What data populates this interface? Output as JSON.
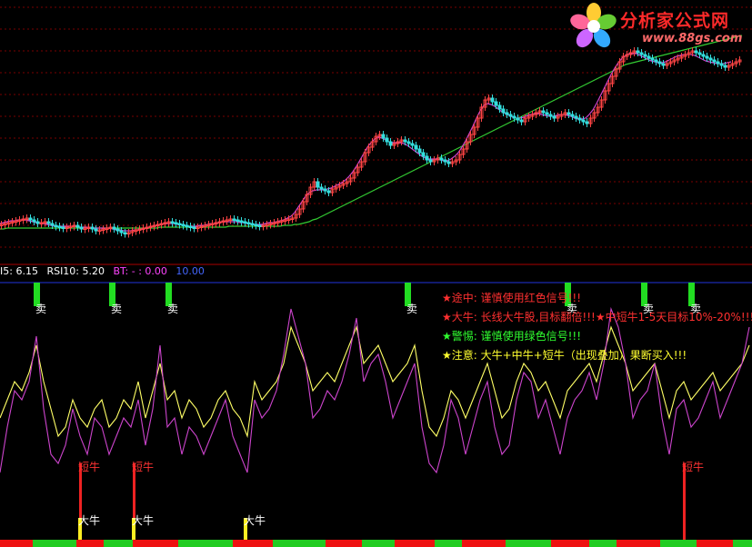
{
  "header": {
    "item1": {
      "label": "I5: 6.15",
      "color": "#ffffff"
    },
    "item2": {
      "label": "RSI10: 5.20",
      "color": "#ffffff"
    },
    "item3": {
      "label": "BT: -  : 0.00",
      "color": "#ff44ff"
    },
    "item4": {
      "label": "10.00",
      "color": "#4466ff"
    }
  },
  "notes": [
    {
      "text": "★途中: 谨慎使用红色信号!!!",
      "color": "#ff3030"
    },
    {
      "text": "★大牛: 长线大牛股,目标翻倍!!!★中短牛1-5天目标10%-20%!!!",
      "color": "#ff3030"
    },
    {
      "text": "★警惕: 谨慎使用绿色信号!!!",
      "color": "#30ff30"
    },
    {
      "text": "★注意: 大牛+中牛+短牛（出现叠加）果断买入!!!",
      "color": "#ffff30"
    }
  ],
  "logo": {
    "title": "分析家公式网",
    "url": "www.88gs.com",
    "icon": "flower-logo-icon"
  },
  "chart_data": [
    {
      "type": "candlestick",
      "panel": "price",
      "x": [
        0,
        4,
        8,
        12,
        16,
        20,
        24,
        28,
        32,
        36,
        40,
        44,
        48,
        52,
        56,
        60,
        64,
        68,
        72,
        76,
        80,
        84,
        88,
        92,
        96,
        100,
        104,
        108,
        112,
        116,
        120,
        124,
        128,
        132,
        136,
        140,
        144,
        148,
        152,
        156,
        160,
        164,
        168,
        172,
        176,
        180,
        184,
        188,
        192,
        196,
        200,
        204,
        208,
        212,
        216,
        220,
        224,
        228,
        232,
        236,
        240,
        244,
        248,
        252,
        256,
        260,
        264,
        268,
        272,
        276,
        280,
        284,
        288,
        292,
        296,
        300,
        304,
        308,
        312,
        316,
        320,
        324,
        328,
        332,
        336,
        340,
        344,
        348,
        352,
        356,
        360,
        364,
        368,
        372,
        376,
        380,
        384,
        388,
        392,
        396,
        400,
        404,
        408,
        412,
        416,
        420,
        424,
        428,
        432,
        436,
        440,
        444,
        448,
        452,
        456,
        460,
        464,
        468,
        472,
        476,
        480,
        484,
        488,
        492,
        496,
        500,
        504,
        508,
        512,
        516,
        520,
        524,
        528,
        532,
        536,
        540,
        544,
        548,
        552,
        556,
        560,
        564,
        568,
        572,
        576,
        580,
        584,
        588,
        592,
        596,
        600,
        604,
        608,
        612,
        616,
        620,
        624,
        628,
        632,
        636,
        640,
        644,
        648,
        652,
        656,
        660,
        664,
        668,
        672,
        676,
        680,
        684,
        688,
        692,
        696,
        700,
        704,
        708,
        712,
        716,
        720,
        724,
        728,
        732,
        736,
        740,
        744,
        748,
        752,
        756,
        760,
        764,
        768,
        772,
        776,
        780,
        784,
        788,
        792,
        796,
        800,
        804,
        808,
        812,
        816,
        820,
        824
      ],
      "close": [
        247,
        246,
        245,
        244,
        243,
        242,
        241,
        240,
        242,
        244,
        246,
        245,
        244,
        246,
        248,
        249,
        250,
        251,
        250,
        249,
        248,
        250,
        252,
        251,
        250,
        252,
        254,
        253,
        252,
        251,
        250,
        252,
        254,
        256,
        257,
        256,
        254,
        253,
        252,
        251,
        250,
        249,
        248,
        247,
        246,
        245,
        244,
        245,
        246,
        247,
        248,
        249,
        250,
        251,
        250,
        249,
        248,
        247,
        246,
        245,
        244,
        243,
        242,
        241,
        242,
        243,
        244,
        245,
        246,
        247,
        248,
        249,
        248,
        247,
        246,
        245,
        244,
        243,
        242,
        241,
        240,
        236,
        230,
        222,
        214,
        206,
        200,
        206,
        208,
        210,
        212,
        208,
        206,
        204,
        202,
        200,
        196,
        190,
        184,
        178,
        168,
        162,
        156,
        150,
        148,
        152,
        156,
        160,
        158,
        156,
        154,
        156,
        158,
        160,
        164,
        168,
        172,
        176,
        178,
        176,
        174,
        176,
        178,
        180,
        178,
        176,
        170,
        164,
        156,
        148,
        140,
        130,
        118,
        110,
        108,
        112,
        116,
        120,
        124,
        126,
        128,
        130,
        132,
        134,
        130,
        128,
        126,
        124,
        122,
        124,
        126,
        128,
        130,
        128,
        126,
        124,
        126,
        128,
        130,
        132,
        134,
        136,
        130,
        124,
        118,
        110,
        100,
        92,
        84,
        76,
        68,
        62,
        60,
        58,
        56,
        58,
        60,
        62,
        64,
        66,
        68,
        70,
        72,
        70,
        68,
        66,
        64,
        62,
        60,
        58,
        56,
        58,
        60,
        62,
        64,
        66,
        68,
        70,
        72,
        74,
        72,
        70,
        68,
        66
      ],
      "ma_short": [
        246,
        245,
        244,
        243,
        243,
        242,
        242,
        242,
        243,
        244,
        245,
        245,
        246,
        247,
        248,
        249,
        249,
        249,
        249,
        249,
        249,
        249,
        250,
        250,
        250,
        251,
        251,
        251,
        251,
        251,
        251,
        252,
        253,
        253,
        254,
        254,
        254,
        253,
        253,
        252,
        251,
        250,
        249,
        248,
        247,
        246,
        246,
        246,
        246,
        247,
        247,
        248,
        249,
        249,
        249,
        248,
        248,
        247,
        246,
        246,
        245,
        244,
        244,
        244,
        244,
        244,
        245,
        245,
        246,
        246,
        247,
        247,
        247,
        246,
        245,
        245,
        244,
        243,
        242,
        240,
        238,
        234,
        228,
        222,
        216,
        212,
        210,
        209,
        209,
        209,
        208,
        207,
        205,
        203,
        201,
        198,
        194,
        189,
        183,
        176,
        169,
        162,
        157,
        153,
        151,
        152,
        154,
        156,
        157,
        157,
        157,
        158,
        160,
        163,
        166,
        169,
        172,
        174,
        175,
        175,
        175,
        176,
        177,
        177,
        175,
        172,
        168,
        162,
        155,
        147,
        139,
        130,
        122,
        116,
        114,
        115,
        117,
        120,
        123,
        125,
        127,
        129,
        130,
        130,
        129,
        127,
        126,
        125,
        125,
        126,
        127,
        128,
        128,
        127,
        126,
        126,
        127,
        128,
        130,
        131,
        131,
        130,
        126,
        121,
        114,
        106,
        98,
        90,
        82,
        75,
        69,
        64,
        61,
        59,
        59,
        59,
        61,
        63,
        65,
        67,
        68,
        69,
        69,
        68,
        66,
        64,
        62,
        61,
        60,
        60,
        60,
        61,
        63,
        65,
        67,
        68,
        69,
        70,
        70,
        70,
        69,
        68
      ],
      "ma_long": [
        252,
        252,
        251,
        251,
        251,
        251,
        251,
        251,
        251,
        251,
        251,
        251,
        251,
        251,
        251,
        251,
        251,
        251,
        251,
        251,
        251,
        251,
        251,
        251,
        251,
        251,
        251,
        251,
        251,
        251,
        251,
        251,
        251,
        251,
        251,
        251,
        251,
        251,
        251,
        251,
        251,
        251,
        251,
        251,
        250,
        250,
        250,
        250,
        250,
        250,
        250,
        250,
        250,
        250,
        250,
        250,
        250,
        250,
        250,
        250,
        250,
        250,
        250,
        249,
        249,
        249,
        249,
        249,
        249,
        249,
        249,
        249,
        249,
        249,
        249,
        249,
        249,
        249,
        248,
        248,
        248,
        247,
        247,
        246,
        245,
        244,
        242,
        241,
        239,
        237,
        235,
        233,
        231,
        229,
        227,
        225,
        223,
        221,
        219,
        217,
        215,
        213,
        211,
        209,
        207,
        205,
        203,
        201,
        199,
        197,
        195,
        193,
        191,
        189,
        187,
        185,
        183,
        181,
        179,
        177,
        175,
        173,
        171,
        169,
        167,
        165,
        163,
        161,
        159,
        157,
        155,
        153,
        151,
        149,
        147,
        145,
        143,
        141,
        139,
        137,
        135,
        133,
        131,
        129,
        127,
        125,
        123,
        121,
        119,
        117,
        115,
        113,
        111,
        109,
        107,
        105,
        103,
        101,
        99,
        97,
        95,
        93,
        91,
        89,
        87,
        85,
        83,
        81,
        79,
        77,
        75,
        73,
        71,
        70,
        69,
        68,
        67,
        66,
        65,
        64,
        63,
        62,
        61,
        60,
        59,
        58,
        57,
        56,
        55,
        54,
        53,
        52,
        51,
        50,
        49,
        48,
        47,
        46,
        45,
        44,
        43,
        42,
        41,
        40,
        39
      ]
    },
    {
      "type": "line",
      "panel": "indicator",
      "x": [
        0,
        8,
        16,
        24,
        32,
        40,
        48,
        56,
        64,
        72,
        80,
        88,
        96,
        104,
        112,
        120,
        128,
        136,
        144,
        152,
        160,
        168,
        176,
        184,
        192,
        200,
        208,
        216,
        224,
        232,
        240,
        248,
        256,
        264,
        272,
        280,
        288,
        296,
        304,
        312,
        320,
        328,
        336,
        344,
        352,
        360,
        368,
        376,
        384,
        392,
        400,
        408,
        416,
        424,
        432,
        440,
        448,
        456,
        464,
        472,
        480,
        488,
        496,
        504,
        512,
        520,
        528,
        536,
        544,
        552,
        560,
        568,
        576,
        584,
        592,
        600,
        608,
        616,
        624,
        632,
        640,
        648,
        656,
        664,
        672,
        680,
        688,
        696,
        704,
        712,
        720,
        728,
        736,
        744,
        752,
        760,
        768,
        776,
        784,
        792,
        800,
        808,
        816,
        824
      ],
      "series": [
        {
          "color": "#ffff66",
          "values": [
            460,
            440,
            420,
            430,
            410,
            380,
            420,
            450,
            480,
            470,
            440,
            460,
            470,
            450,
            440,
            470,
            460,
            440,
            450,
            420,
            460,
            430,
            400,
            440,
            430,
            460,
            440,
            450,
            470,
            460,
            440,
            430,
            450,
            460,
            480,
            420,
            440,
            430,
            420,
            400,
            360,
            380,
            400,
            430,
            420,
            410,
            420,
            400,
            380,
            360,
            400,
            390,
            380,
            400,
            420,
            410,
            400,
            380,
            430,
            470,
            480,
            460,
            430,
            440,
            460,
            440,
            420,
            400,
            430,
            460,
            450,
            420,
            400,
            410,
            430,
            420,
            440,
            460,
            430,
            420,
            410,
            400,
            420,
            390,
            360,
            380,
            400,
            430,
            420,
            410,
            400,
            430,
            460,
            430,
            420,
            440,
            430,
            420,
            410,
            430,
            420,
            410,
            400,
            380
          ]
        },
        {
          "color": "#cc44cc",
          "values": [
            520,
            470,
            430,
            440,
            420,
            370,
            450,
            500,
            510,
            490,
            450,
            480,
            500,
            460,
            470,
            500,
            480,
            460,
            470,
            440,
            490,
            450,
            380,
            470,
            460,
            500,
            470,
            480,
            500,
            480,
            460,
            440,
            480,
            500,
            520,
            440,
            460,
            450,
            430,
            390,
            340,
            370,
            400,
            460,
            450,
            430,
            440,
            420,
            390,
            350,
            420,
            400,
            390,
            420,
            460,
            440,
            420,
            400,
            470,
            510,
            520,
            490,
            440,
            460,
            500,
            470,
            440,
            420,
            470,
            500,
            490,
            440,
            410,
            420,
            460,
            440,
            470,
            500,
            460,
            440,
            430,
            410,
            440,
            400,
            340,
            360,
            400,
            460,
            440,
            430,
            400,
            460,
            500,
            450,
            440,
            470,
            460,
            440,
            420,
            460,
            440,
            420,
            400,
            360
          ]
        }
      ]
    }
  ],
  "signals": {
    "sell_label": "卖",
    "sell_x": [
      40,
      123,
      185,
      448,
      624,
      708,
      760
    ],
    "duanniu_label": "短牛",
    "duanniu_x": [
      88,
      147,
      752
    ],
    "daniu_label": "大牛",
    "daniu_x": [
      88,
      147,
      270
    ]
  }
}
